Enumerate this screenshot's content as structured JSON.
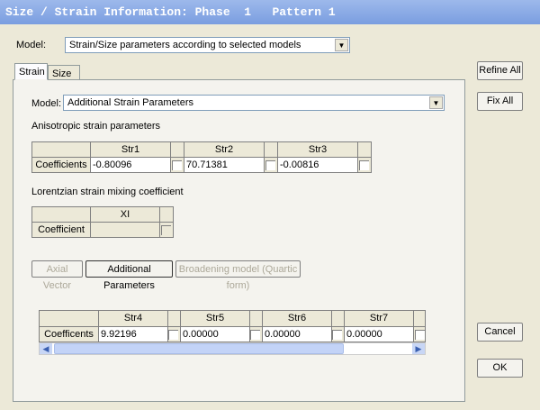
{
  "title": "Size / Strain Information: Phase  1   Pattern 1",
  "model_label": "Model:",
  "model_value": "Strain/Size parameters according to selected models",
  "tabs": [
    "Strain",
    "Size"
  ],
  "buttons": {
    "refine_all": "Refine All",
    "fix_all": "Fix All",
    "cancel": "Cancel",
    "ok": "OK"
  },
  "strain": {
    "model_label": "Model:",
    "model_value": "Additional Strain Parameters",
    "aniso_label": "Anisotropic strain parameters",
    "aniso_table": {
      "row_label": "Coefficients",
      "columns": [
        "Str1",
        "Str2",
        "Str3"
      ],
      "values": [
        "-0.80096",
        "70.71381",
        "-0.00816"
      ]
    },
    "lorentz_label": "Lorentzian strain mixing coefficient",
    "lorentz_table": {
      "row_label": "Coefficient",
      "columns": [
        "XI"
      ],
      "values": [
        ""
      ]
    },
    "sub_buttons": [
      "Axial Vector",
      "Additional Parameters",
      "Broadening model (Quartic form)"
    ],
    "add_table": {
      "row_label": "Coefficents",
      "columns": [
        "Str4",
        "Str5",
        "Str6",
        "Str7"
      ],
      "values": [
        "9.92196",
        "0.00000",
        "0.00000",
        "0.00000"
      ]
    }
  }
}
